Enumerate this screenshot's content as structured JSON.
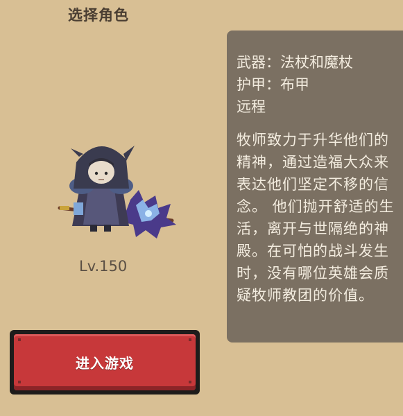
{
  "header": {
    "title": "选择角色"
  },
  "character": {
    "icon": "priest-character-sprite",
    "level": "Lv.150"
  },
  "info": {
    "weapon": "武器：法杖和魔杖",
    "armor": "护甲：布甲",
    "range": "远程",
    "description": "牧师致力于升华他们的精神，通过造福大众来表达他们坚定不移的信念。 他们抛开舒适的生活，离开与世隔绝的神殿。在可怕的战斗发生时，没有哪位英雄会质疑牧师教团的价值。"
  },
  "actions": {
    "enter_game_label": "进入游戏"
  },
  "colors": {
    "background": "#d8bf94",
    "panel": "#7b7062",
    "button": "#c7383a",
    "button_frame": "#1e1c1b"
  }
}
